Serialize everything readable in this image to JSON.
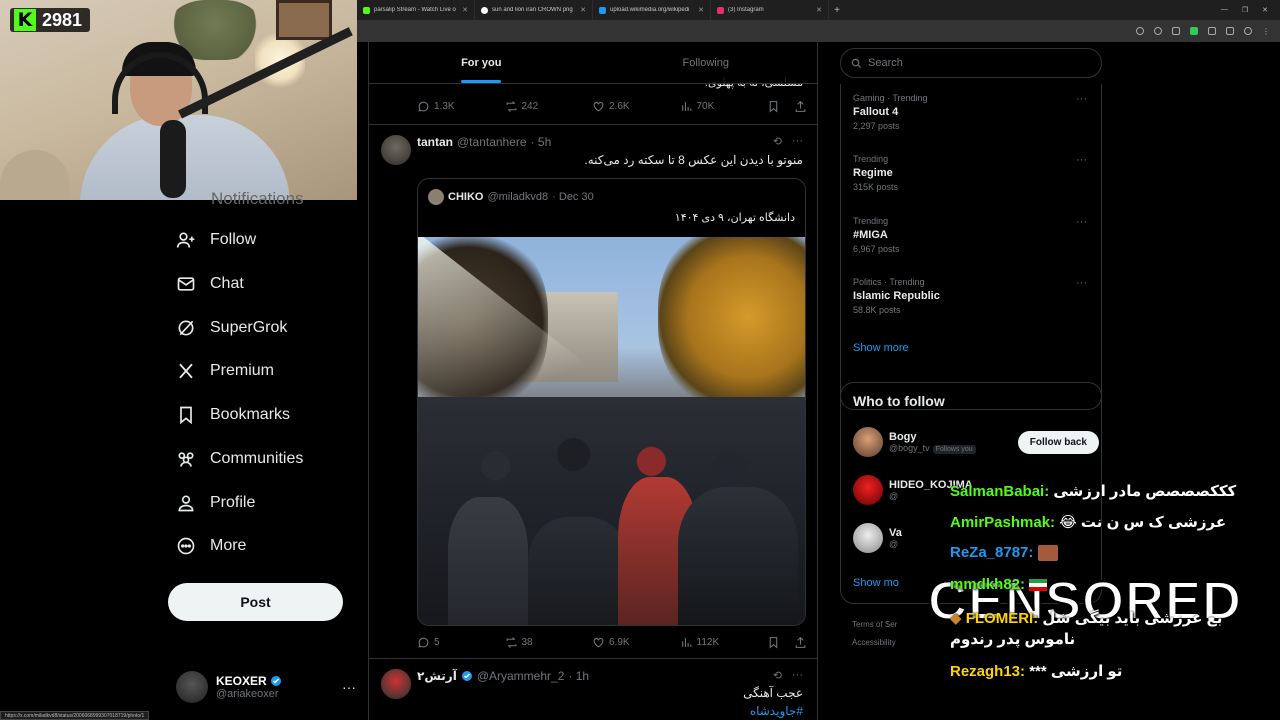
{
  "browser": {
    "tabs": [
      {
        "title": "parsalip Stream - Watch Live o",
        "color": "#53fc18"
      },
      {
        "title": "sun and lion iran CROWN png",
        "color": "#ffffff"
      },
      {
        "title": "upload.wikimedia.org/wikipedi",
        "color": "#1d9bf0"
      },
      {
        "title": "(3) Instagram",
        "color": "#e1306c"
      }
    ],
    "new_tab": "+",
    "status_url": "https://x.com/miladkvd8/status/2006068999307018719/photo/1"
  },
  "stream": {
    "viewer_count": "2981",
    "logo": "K"
  },
  "nav": {
    "peek": "Notifications",
    "items": [
      {
        "label": "Follow",
        "icon": "person-add-icon"
      },
      {
        "label": "Chat",
        "icon": "mail-icon"
      },
      {
        "label": "SuperGrok",
        "icon": "grok-icon"
      },
      {
        "label": "Premium",
        "icon": "x-logo-icon"
      },
      {
        "label": "Bookmarks",
        "icon": "bookmark-icon"
      },
      {
        "label": "Communities",
        "icon": "communities-icon"
      },
      {
        "label": "Profile",
        "icon": "profile-icon"
      },
      {
        "label": "More",
        "icon": "more-circle-icon"
      }
    ],
    "post_label": "Post",
    "account": {
      "name": "KEOXER",
      "handle": "@ariakeoxer",
      "more": "···"
    }
  },
  "feed": {
    "tabs": [
      {
        "label": "For you",
        "active": true
      },
      {
        "label": "Following",
        "active": false
      }
    ],
    "prev_tweet": {
      "peek_text": "مسلسی، نه به پهلوی.",
      "replies": "1.3K",
      "reposts": "242",
      "likes": "2.6K",
      "views": "70K"
    },
    "tweet1": {
      "name": "tantan",
      "handle": "@tantanhere",
      "time": "· 5h",
      "text": "منوتو با دیدن این عکس 8 تا سکته رد می‌کنه.",
      "quote": {
        "name": "CHIKO",
        "handle": "@miladkvd8",
        "time": "· Dec 30",
        "text": "دانشگاه تهران، ۹ دی ۱۴۰۴"
      },
      "replies": "5",
      "reposts": "38",
      "likes": "6.9K",
      "views": "112K"
    },
    "tweet2": {
      "name": "آرتش۲",
      "handle": "@Aryammehr_2",
      "time": "· 1h",
      "text": "عجب آهنگی",
      "hashtag": "#جاویدشاه"
    }
  },
  "right": {
    "search_placeholder": "Search",
    "trends": [
      {
        "category": "Gaming · Trending",
        "title": "Fallout 4",
        "count": "2,297 posts"
      },
      {
        "category": "Trending",
        "title": "Regime",
        "count": "315K posts"
      },
      {
        "category": "Trending",
        "title": "#MIGA",
        "count": "6,967 posts"
      },
      {
        "category": "Politics · Trending",
        "title": "Islamic Republic",
        "count": "58.8K posts"
      }
    ],
    "trends_show_more": "Show more",
    "who_to_follow": {
      "title": "Who to follow",
      "users": [
        {
          "name": "Bogy",
          "handle": "@bogy_tv",
          "badge": "Follows you",
          "button": "Follow back"
        },
        {
          "name": "HIDEO_KOJIMA",
          "handle": "@",
          "badge": "",
          "button": ""
        },
        {
          "name": "Va",
          "handle": "@",
          "badge": "",
          "button": ""
        }
      ],
      "show_more": "Show mo"
    },
    "footer": [
      "Terms of Ser",
      "Accessibility"
    ]
  },
  "chat": {
    "messages": [
      {
        "user": "SalmanBabai:",
        "text": "کککصصصص مادر ارزشی",
        "color": "#53fc18"
      },
      {
        "user": "AmirPashmak:",
        "text": "عرزشی ک س ن نت 😂",
        "color": "#53fc18"
      },
      {
        "user": "ReZa_8787:",
        "text": "",
        "color": "#1d9bf0"
      },
      {
        "user": "mmdkh82:",
        "text": "",
        "color": "#53fc18"
      },
      {
        "user": "FLOMERI:",
        "text": "بع عرزشی باید بیگی شل ناموس پدر رندوم",
        "color": "#ffd400"
      },
      {
        "user": "Rezagh13:",
        "text": "تو ارزشی ***",
        "color": "#ffd400"
      }
    ],
    "censored": "CENSORED"
  }
}
